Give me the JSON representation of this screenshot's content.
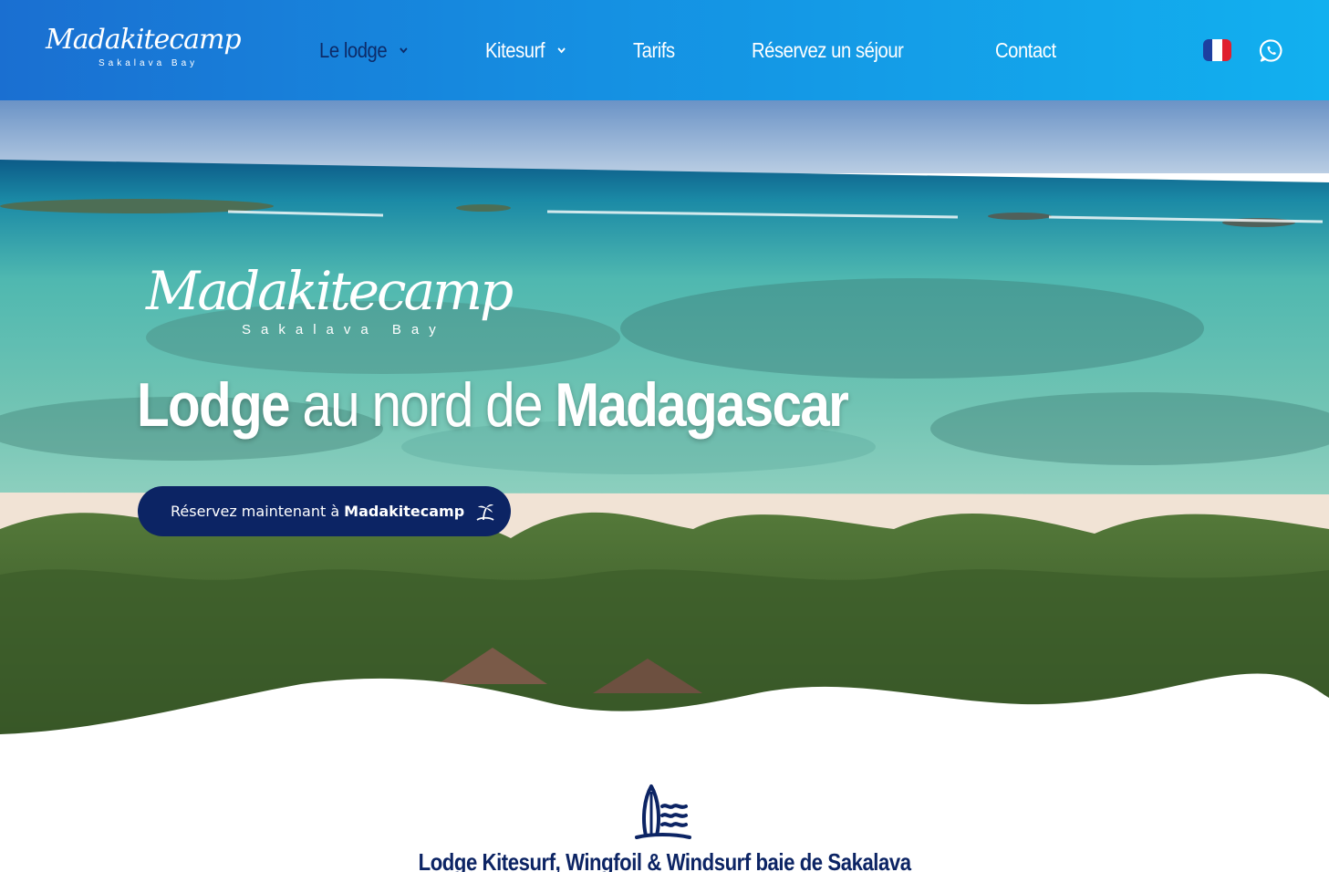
{
  "header": {
    "logo": {
      "script": "Madakitecamp",
      "sub": "Sakalava Bay"
    },
    "nav": [
      {
        "label": "Le lodge",
        "has_dropdown": true,
        "active": true
      },
      {
        "label": "Kitesurf",
        "has_dropdown": true,
        "active": false
      },
      {
        "label": "Tarifs",
        "has_dropdown": false,
        "active": false
      },
      {
        "label": "Réservez un séjour",
        "has_dropdown": false,
        "active": false
      },
      {
        "label": "Contact",
        "has_dropdown": false,
        "active": false
      }
    ],
    "language_flag": "france-flag-icon",
    "whatsapp_icon": "whatsapp-icon"
  },
  "hero": {
    "logo": {
      "script": "Madakitecamp",
      "sub": "Sakalava Bay"
    },
    "title": {
      "part1": "Lodge",
      "part2": "au nord de",
      "part3": "Madagascar"
    },
    "cta": {
      "prefix": "Réservez maintenant à",
      "brand": "Madakitecamp",
      "icon": "palm-island-icon"
    }
  },
  "intro": {
    "icon": "surfboard-waves-icon",
    "title": {
      "t1": "Lodge",
      "t2": "Kitesurf",
      "t3": ", Wingfoil &",
      "t4": "Windsurf",
      "t5": "baie de",
      "t6": "Sakalava"
    }
  },
  "colors": {
    "header_start": "#1a6fd1",
    "header_end": "#12b0ef",
    "navy": "#0c2464",
    "active_nav": "#0d2b68",
    "white": "#ffffff"
  }
}
